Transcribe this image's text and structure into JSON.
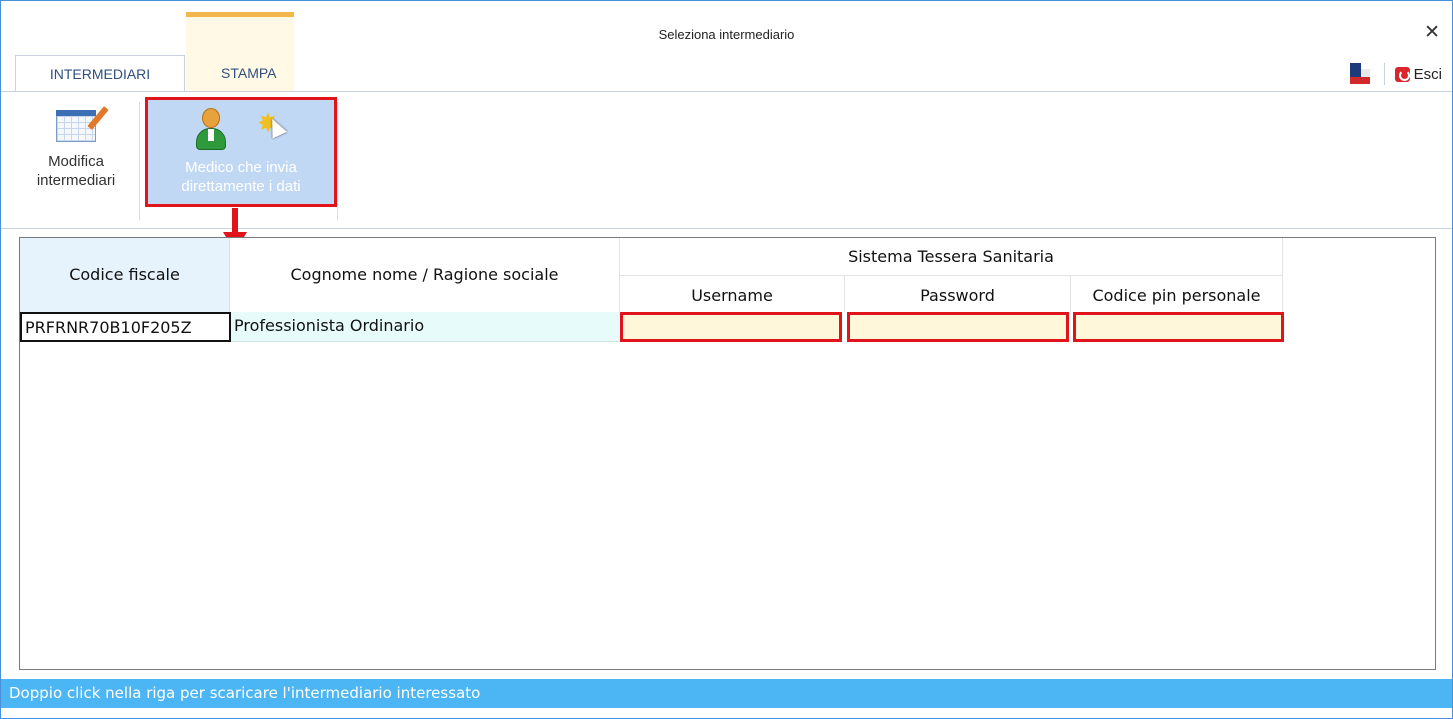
{
  "window": {
    "title": "Seleziona intermediario",
    "close_glyph": "✕"
  },
  "tabs": [
    {
      "label": "INTERMEDIARI",
      "active": true
    },
    {
      "label": "STAMPA",
      "active": false
    }
  ],
  "toolbar_right": {
    "flag_icon": "flag-icon",
    "exit_label": "Esci"
  },
  "ribbon": {
    "modifica": {
      "line1": "Modifica",
      "line2": "intermediari",
      "icon": "grid-edit-icon"
    },
    "medico": {
      "line1": "Medico che invia",
      "line2": "direttamente i dati",
      "icons": [
        "person-icon",
        "new-cursor-icon"
      ],
      "highlighted": true
    }
  },
  "grid": {
    "headers": {
      "codice_fiscale": "Codice fiscale",
      "cognome_nome": "Cognome nome / Ragione sociale",
      "group": "Sistema Tessera Sanitaria",
      "username": "Username",
      "password": "Password",
      "pin": "Codice pin personale"
    },
    "rows": [
      {
        "codice_fiscale": "PRFRNR70B10F205Z",
        "cognome_nome": "Professionista Ordinario",
        "username": "",
        "password": "",
        "pin": ""
      }
    ]
  },
  "status_bar": {
    "text": "Doppio click nella riga per scaricare l'intermediario interessato"
  },
  "colors": {
    "highlight_red": "#e0141b",
    "status_blue": "#4cb6f5",
    "ribbon_selected": "#c1d8f5",
    "empty_field": "#fff7d9"
  }
}
